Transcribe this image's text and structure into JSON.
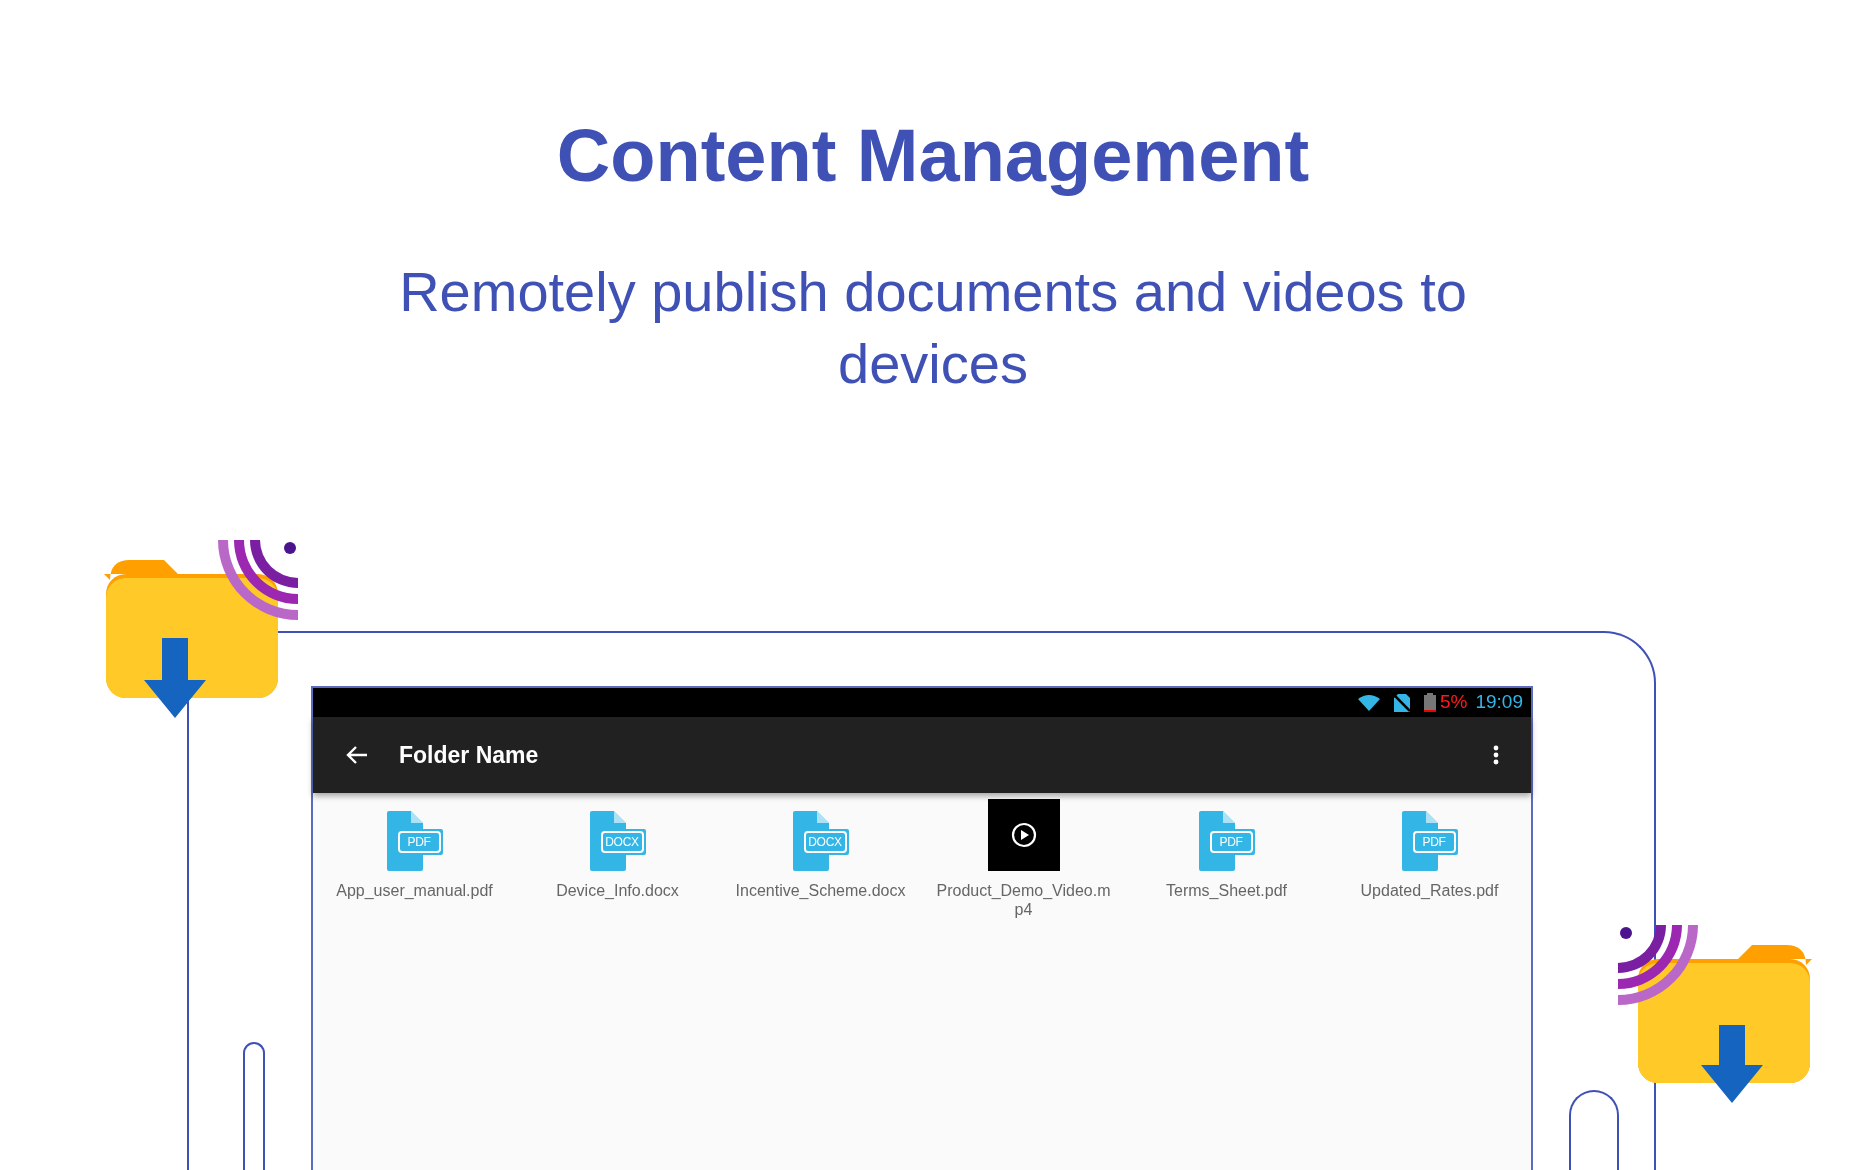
{
  "heading": "Content Management",
  "subtitle": "Remotely publish documents and videos to devices",
  "status_bar": {
    "battery": "5%",
    "time": "19:09"
  },
  "toolbar": {
    "title": "Folder Name"
  },
  "files": [
    {
      "name": "App_user_manual.pdf",
      "kind": "document",
      "badge": "PDF"
    },
    {
      "name": "Device_Info.docx",
      "kind": "document",
      "badge": "DOCX"
    },
    {
      "name": "Incentive_Scheme.docx",
      "kind": "document",
      "badge": "DOCX"
    },
    {
      "name": "Product_Demo_Video.mp4",
      "kind": "video"
    },
    {
      "name": "Terms_Sheet.pdf",
      "kind": "document",
      "badge": "PDF"
    },
    {
      "name": "Updated_Rates.pdf",
      "kind": "document",
      "badge": "PDF"
    }
  ]
}
